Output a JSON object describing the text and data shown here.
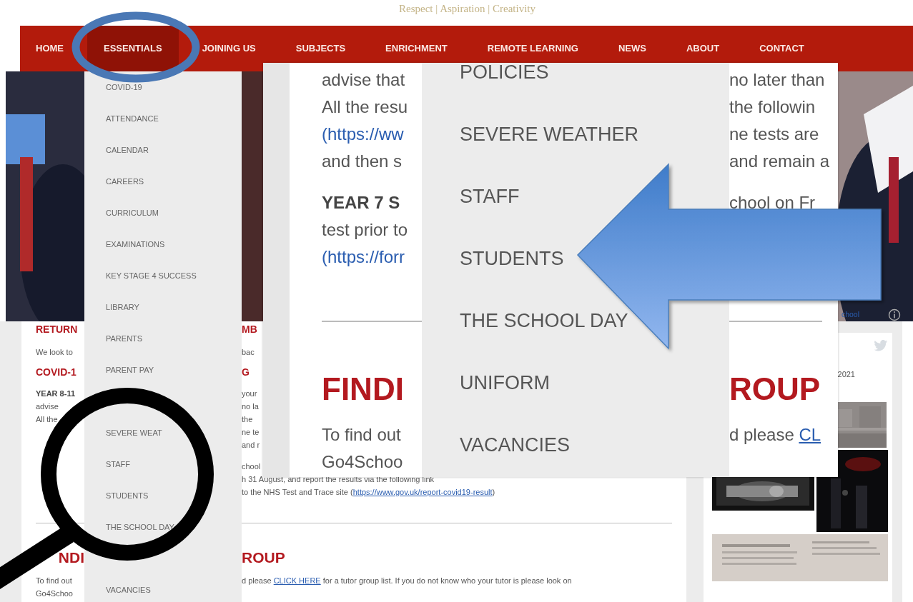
{
  "tagline": "Respect | Aspiration | Creativity",
  "nav": [
    {
      "label": "HOME",
      "selected": false
    },
    {
      "label": "ESSENTIALS",
      "selected": true
    },
    {
      "label": "JOINING US",
      "selected": false
    },
    {
      "label": "SUBJECTS",
      "selected": false
    },
    {
      "label": "ENRICHMENT",
      "selected": false
    },
    {
      "label": "REMOTE LEARNING",
      "selected": false
    },
    {
      "label": "NEWS",
      "selected": false
    },
    {
      "label": "ABOUT",
      "selected": false
    },
    {
      "label": "CONTACT",
      "selected": false
    }
  ],
  "dropdown": {
    "items_upper": [
      "COVID-19",
      "ATTENDANCE",
      "CALENDAR",
      "CAREERS",
      "CURRICULUM",
      "EXAMINATIONS",
      "KEY STAGE 4 SUCCESS",
      "LIBRARY",
      "PARENTS",
      "PARENT PAY"
    ],
    "items_lower": [
      "SEVERE WEAT",
      "STAFF",
      "STUDENTS",
      "THE SCHOOL DAY"
    ],
    "items_bottom": [
      "VACANCIES"
    ]
  },
  "content": [
    {
      "kind": "heading",
      "left": "RETURN",
      "right": [
        {
          "text": "MB",
          "link": false
        }
      ]
    },
    {
      "kind": "para",
      "left": "We look to",
      "right": [
        {
          "text": "bac",
          "link": false
        }
      ]
    },
    {
      "kind": "heading",
      "left": "COVID-1",
      "right": [
        {
          "text": "G",
          "link": false
        }
      ]
    },
    {
      "kind": "bold",
      "left": "YEAR 8-11",
      "right": [
        {
          "text": "your",
          "link": false
        }
      ]
    },
    {
      "kind": "text",
      "left": "advise",
      "right": [
        {
          "text": "no la",
          "link": false
        }
      ]
    },
    {
      "kind": "text",
      "left": "All the",
      "right": [
        {
          "text": "the",
          "link": false
        }
      ]
    },
    {
      "kind": "text",
      "right": [
        {
          "text": "ne te",
          "link": false
        }
      ]
    },
    {
      "kind": "text",
      "right": [
        {
          "text": "and r",
          "link": false
        }
      ]
    },
    {
      "kind": "para",
      "right": [
        {
          "text": "chool",
          "link": false
        }
      ]
    },
    {
      "kind": "text",
      "right": [
        {
          "text": "h 31 August, and report the results via the following link",
          "link": false
        }
      ]
    },
    {
      "kind": "text",
      "right": [
        {
          "text": "to the NHS Test and Trace site (",
          "link": false
        },
        {
          "text": "https://www.gov.uk/report-covid19-result",
          "link": true
        },
        {
          "text": ")",
          "link": false
        }
      ]
    },
    {
      "kind": "rule"
    },
    {
      "kind": "title",
      "left": "NDI",
      "right": [
        {
          "text": "ROUP",
          "link": false
        }
      ]
    },
    {
      "kind": "para",
      "left": "To find out",
      "right": [
        {
          "text": "d please ",
          "link": false
        },
        {
          "text": "CLICK HERE",
          "link": true
        },
        {
          "text": " for a tutor group list. If you do not know who your tutor is please look on",
          "link": false
        }
      ]
    },
    {
      "kind": "text",
      "left": "Go4Schoo"
    }
  ],
  "sidebar": {
    "link": "chool",
    "date": "2021"
  },
  "inset": {
    "dropdown": [
      "POLICIES",
      "SEVERE WEATHER",
      "STAFF",
      "STUDENTS",
      "THE SCHOOL DAY",
      "UNIFORM",
      "VACANCIES"
    ],
    "content": [
      {
        "kind": "text",
        "left": "advise that",
        "right": [
          {
            "text": "no later than",
            "link": false
          }
        ]
      },
      {
        "kind": "text",
        "left": "All the resu",
        "right": [
          {
            "text": "the followin",
            "link": false
          }
        ]
      },
      {
        "kind": "text",
        "left": "(https://ww",
        "left_link": true,
        "right": [
          {
            "text": "ne tests are",
            "link": false
          }
        ]
      },
      {
        "kind": "text",
        "left": "and then s",
        "right": [
          {
            "text": "and remain a",
            "link": false
          }
        ]
      },
      {
        "kind": "bold",
        "left": "YEAR 7 S",
        "right": [
          {
            "text": "chool on Fr",
            "link": false
          }
        ]
      },
      {
        "kind": "text",
        "left": "test prior to"
      },
      {
        "kind": "text",
        "left": "(https://forr",
        "left_link": true
      },
      {
        "kind": "rule"
      },
      {
        "kind": "title",
        "left": "FINDI",
        "right": [
          {
            "text": "ROUP",
            "link": false
          }
        ]
      },
      {
        "kind": "para",
        "left": "To find out",
        "right": [
          {
            "text": "d please ",
            "link": false
          },
          {
            "text": "CL",
            "link": true
          }
        ]
      },
      {
        "kind": "text",
        "left": "Go4Schoo"
      }
    ]
  }
}
